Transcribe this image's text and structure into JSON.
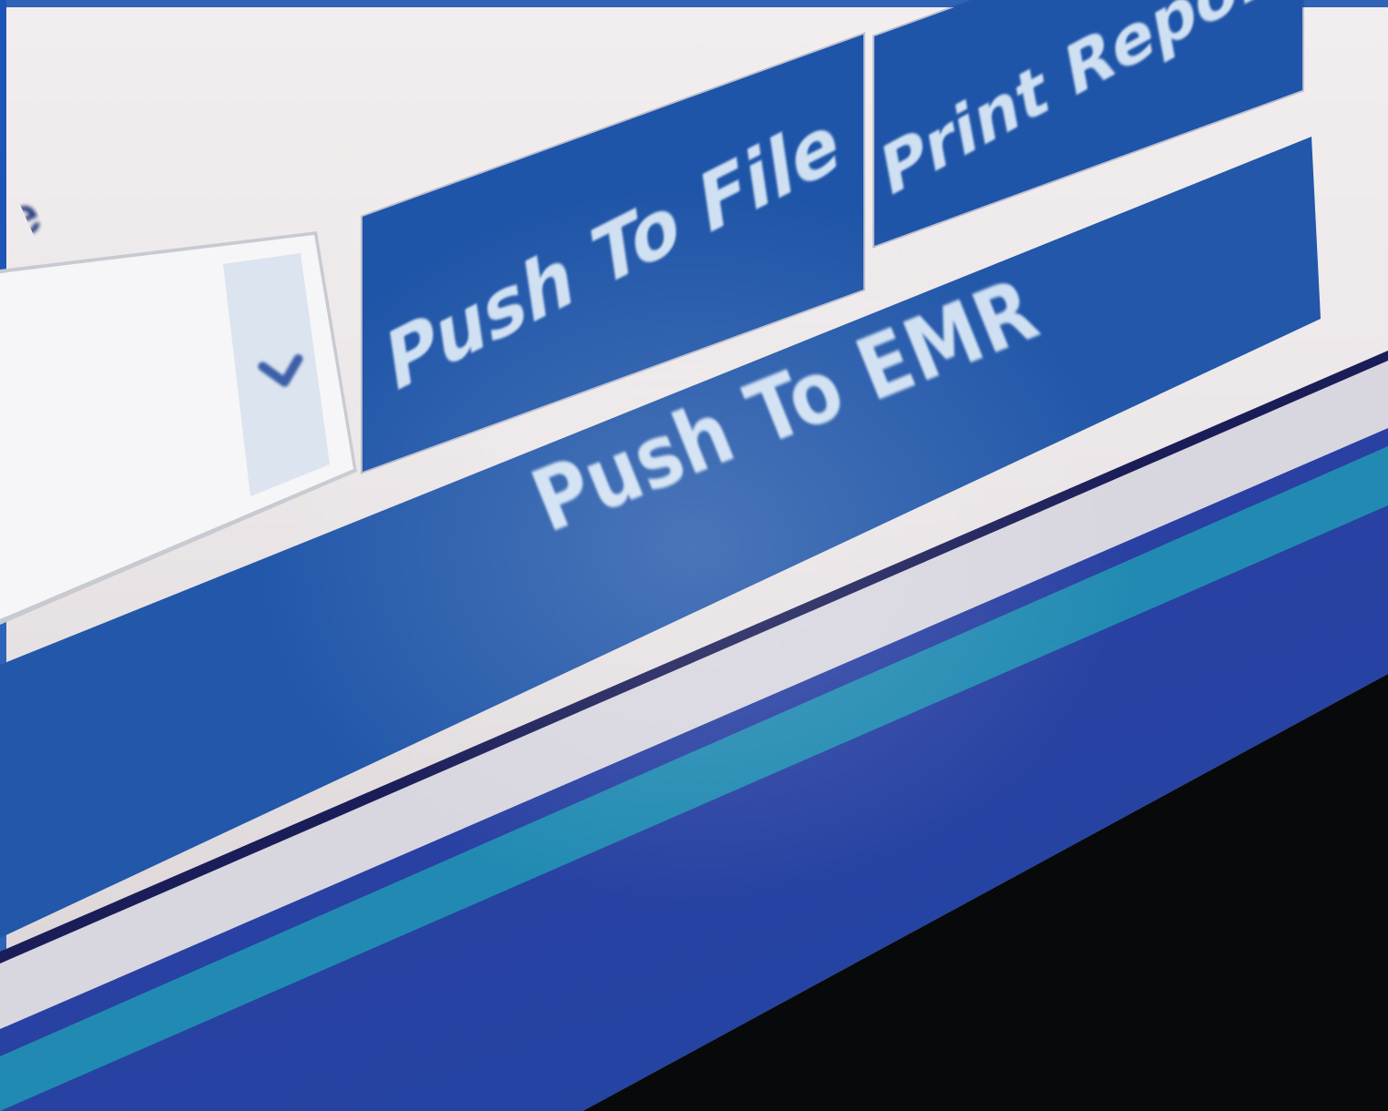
{
  "window": {
    "label_fragment": "e"
  },
  "toolbar": {
    "print_report_label": "Print Report",
    "push_to_file_label": "Push To File",
    "push_to_emr_label": "Push To EMR"
  },
  "dropdown": {
    "selected_value": "",
    "chevron_icon": "chevron-down-icon"
  },
  "colors": {
    "button_blue": "#1f55a8",
    "button_text": "#cfe0f2",
    "window_background": "#f2eeef",
    "lower_band": "#2b40a2",
    "teal_band": "#1d8ab3",
    "bezel": "#07090b"
  }
}
